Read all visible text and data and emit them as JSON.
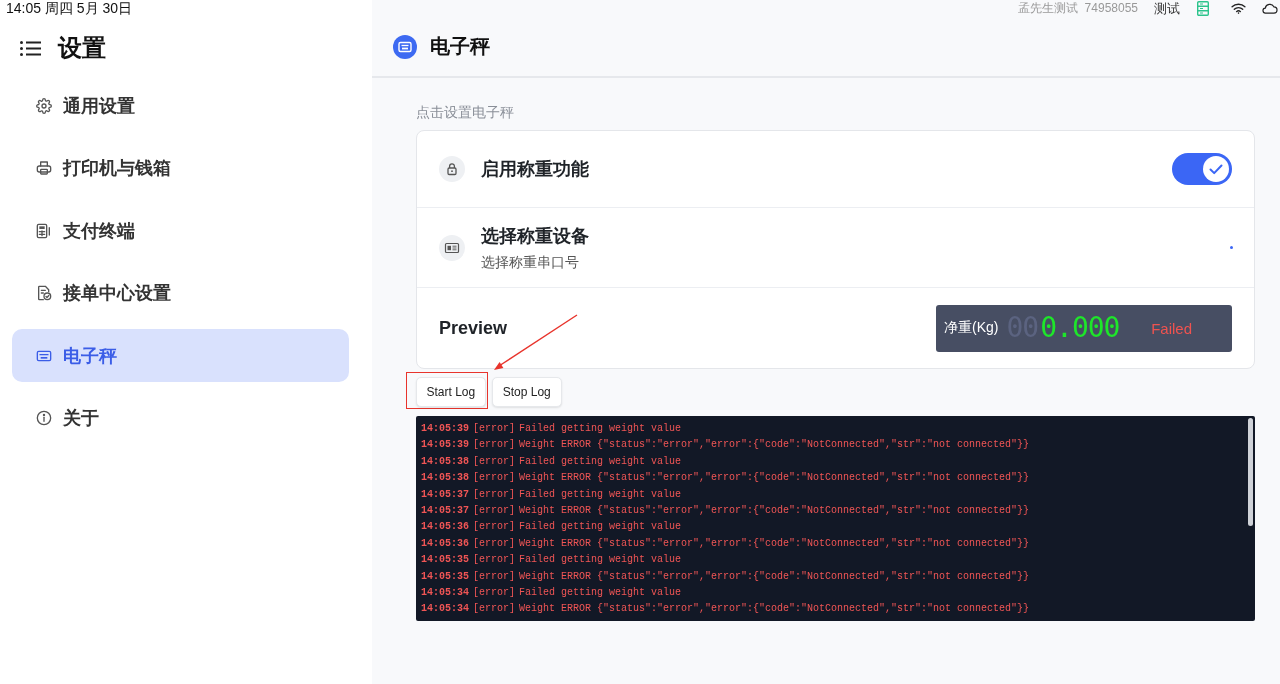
{
  "status_bar": {
    "time": "14:05 周四 5月 30日",
    "account": "孟先生测试  74958055",
    "mode": "测试"
  },
  "sidebar": {
    "title": "设置",
    "items": [
      {
        "label": "通用设置",
        "selected": false
      },
      {
        "label": "打印机与钱箱",
        "selected": false
      },
      {
        "label": "支付终端",
        "selected": false
      },
      {
        "label": "接单中心设置",
        "selected": false
      },
      {
        "label": "电子秤",
        "selected": true
      },
      {
        "label": "关于",
        "selected": false
      }
    ]
  },
  "page": {
    "title": "电子秤",
    "hint": "点击设置电子秤"
  },
  "settings": [
    {
      "kind": "toggle",
      "title": "启用称重功能",
      "on": true
    },
    {
      "kind": "select",
      "title": "选择称重设备",
      "subtitle": "选择称重串口号"
    },
    {
      "kind": "preview",
      "title": "Preview",
      "label": "净重(Kg)",
      "ghost_digits": "00",
      "value": "0.000",
      "status": "Failed"
    }
  ],
  "log_buttons": [
    {
      "label": "Start Log",
      "highlighted": true
    },
    {
      "label": "Stop Log",
      "highlighted": false
    }
  ],
  "log": [
    {
      "time": "14:05:39",
      "level": "[error]",
      "message": "Failed getting weight value"
    },
    {
      "time": "14:05:39",
      "level": "[error]",
      "message": "Weight ERROR {\"status\":\"error\",\"error\":{\"code\":\"NotConnected\",\"str\":\"not connected\"}}"
    },
    {
      "time": "14:05:38",
      "level": "[error]",
      "message": "Failed getting weight value"
    },
    {
      "time": "14:05:38",
      "level": "[error]",
      "message": "Weight ERROR {\"status\":\"error\",\"error\":{\"code\":\"NotConnected\",\"str\":\"not connected\"}}"
    },
    {
      "time": "14:05:37",
      "level": "[error]",
      "message": "Failed getting weight value"
    },
    {
      "time": "14:05:37",
      "level": "[error]",
      "message": "Weight ERROR {\"status\":\"error\",\"error\":{\"code\":\"NotConnected\",\"str\":\"not connected\"}}"
    },
    {
      "time": "14:05:36",
      "level": "[error]",
      "message": "Failed getting weight value"
    },
    {
      "time": "14:05:36",
      "level": "[error]",
      "message": "Weight ERROR {\"status\":\"error\",\"error\":{\"code\":\"NotConnected\",\"str\":\"not connected\"}}"
    },
    {
      "time": "14:05:35",
      "level": "[error]",
      "message": "Failed getting weight value"
    },
    {
      "time": "14:05:35",
      "level": "[error]",
      "message": "Weight ERROR {\"status\":\"error\",\"error\":{\"code\":\"NotConnected\",\"str\":\"not connected\"}}"
    },
    {
      "time": "14:05:34",
      "level": "[error]",
      "message": "Failed getting weight value"
    },
    {
      "time": "14:05:34",
      "level": "[error]",
      "message": "Weight ERROR {\"status\":\"error\",\"error\":{\"code\":\"NotConnected\",\"str\":\"not connected\"}}"
    }
  ]
}
